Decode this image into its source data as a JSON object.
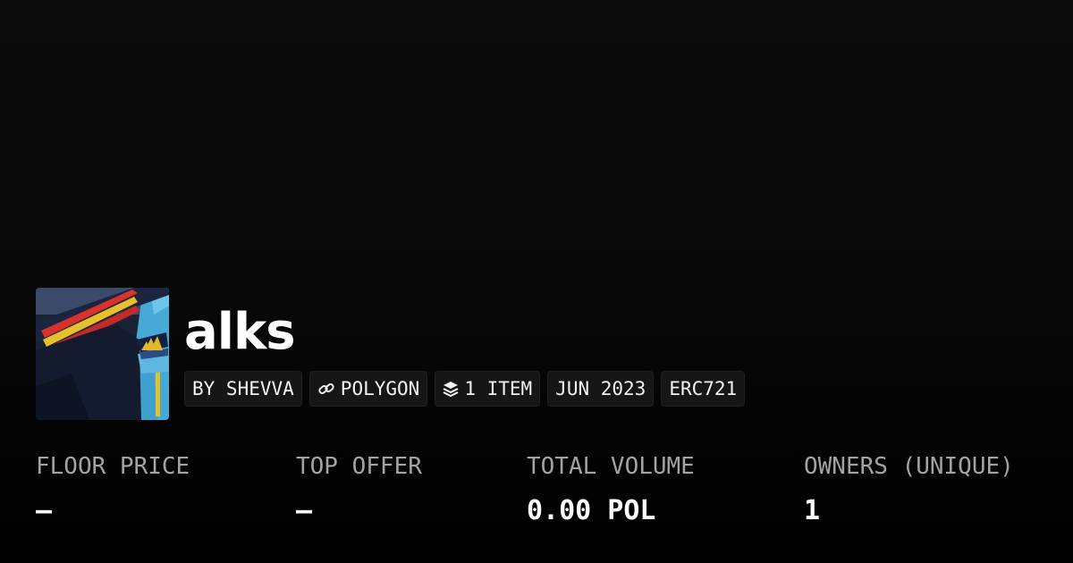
{
  "collection": {
    "name": "alks",
    "avatar_icon": "collection-avatar-image"
  },
  "chips": {
    "creator": "BY SHEVVA",
    "chain": "POLYGON",
    "chain_icon": "link-icon",
    "items": "1 ITEM",
    "items_icon": "layers-icon",
    "date": "JUN 2023",
    "standard": "ERC721"
  },
  "stats": [
    {
      "label": "FLOOR PRICE",
      "value": "–"
    },
    {
      "label": "TOP OFFER",
      "value": "–"
    },
    {
      "label": "TOTAL VOLUME",
      "value": "0.00 POL"
    },
    {
      "label": "OWNERS (UNIQUE)",
      "value": "1"
    }
  ],
  "colors": {
    "background": "#0b0b0b",
    "chip_background": "#161616",
    "label": "#a3a3a3",
    "text": "#ffffff"
  }
}
